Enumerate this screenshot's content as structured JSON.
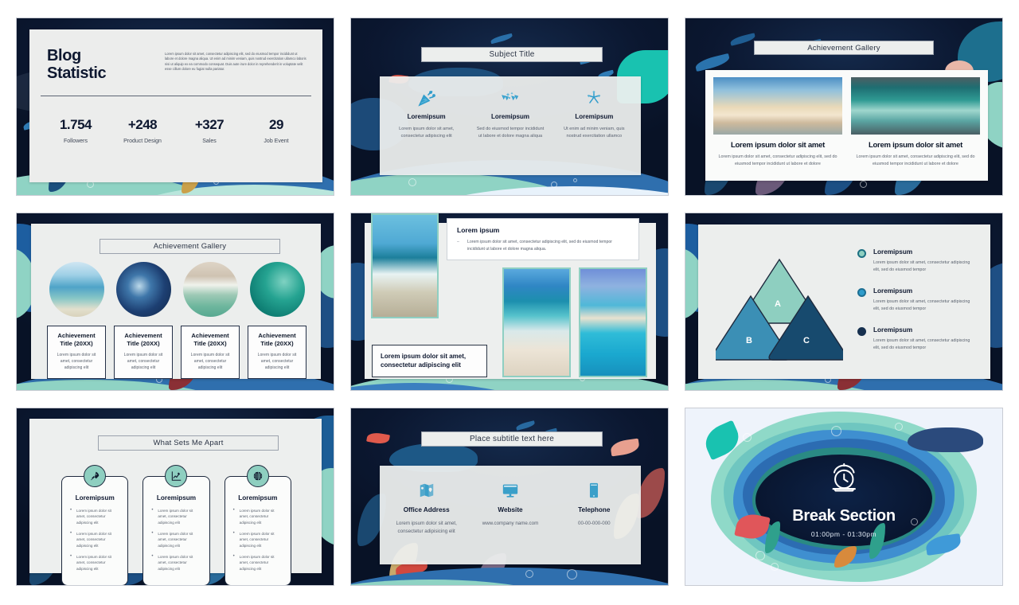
{
  "deck": {
    "theme_colors": {
      "deep_navy": "#0b1730",
      "panel_grey": "#eceeed",
      "teal": "#8ecfc0",
      "mid_blue": "#3b8fb5",
      "dark_blue": "#174a6e",
      "accent_blue": "#2f9ccb",
      "text_dark": "#0e1830",
      "text_body": "#5b636f"
    },
    "slides": [
      {
        "id": "blog-statistic",
        "title_line1": "Blog",
        "title_line2": "Statistic",
        "paragraph": "Lorem ipsum dolor sit amet, consectetur adipiscing elit, sed do eiusmod tempor incididunt ut labore et dolore magna aliqua. Ut enim ad minim veniam, quis nostrud exercitation ullamco laboris nisi ut aliquip ex ea commodo consequat. Duis aute irure dolor in reprehenderit in voluptate velit esse cillum dolore eu fugiat nulla pariatur.",
        "stats": [
          {
            "value": "1.754",
            "label": "Followers"
          },
          {
            "value": "+248",
            "label": "Product Design"
          },
          {
            "value": "+327",
            "label": "Sales"
          },
          {
            "value": "29",
            "label": "Job Event"
          }
        ]
      },
      {
        "id": "subject-title",
        "title": "Subject Title",
        "columns": [
          {
            "icon": "party-popper-icon",
            "heading": "Loremipsum",
            "text": "Lorem ipsum dolor sit amet, consectetur adipiscing elit"
          },
          {
            "icon": "bunting-flags-icon",
            "heading": "Loremipsum",
            "text": "Sed do eiusmod tempor incididunt ut labore et dolore magna aliqua"
          },
          {
            "icon": "fireworks-icon",
            "heading": "Loremipsum",
            "text": "Ut enim ad minim veniam, quis nostrud exercitation ullamco"
          }
        ]
      },
      {
        "id": "achievement-gallery-two-up",
        "title": "Achievement Gallery",
        "cards": [
          {
            "image": "beach-sunset-birds-photo",
            "heading": "Lorem ipsum dolor sit amet",
            "text": "Lorem ipsum dolor sit amet, consectetur adipiscing elit, sed do eiusmod tempor incididunt ut labore et dolore"
          },
          {
            "image": "ocean-wave-photo",
            "heading": "Lorem ipsum dolor sit amet",
            "text": "Lorem ipsum dolor sit amet, consectetur adipiscing elit, sed do eiusmod tempor incididunt ut labore et dolore"
          }
        ]
      },
      {
        "id": "achievement-gallery-four-up",
        "title": "Achievement Gallery",
        "cards": [
          {
            "image": "beach-crowd-photo",
            "heading": "Achievement Title (20XX)",
            "text": "Lorem ipsum dolor sit amet, consectetur adipiscing elit"
          },
          {
            "image": "surfer-barrel-wave-photo",
            "heading": "Achievement Title (20XX)",
            "text": "Lorem ipsum dolor sit amet, consectetur adipiscing elit"
          },
          {
            "image": "aerial-shoreline-photo",
            "heading": "Achievement Title (20XX)",
            "text": "Lorem ipsum dolor sit amet, consectetur adipiscing elit"
          },
          {
            "image": "teal-surf-photo",
            "heading": "Achievement Title (20XX)",
            "text": "Lorem ipsum dolor sit amet, consectetur adipiscing elit"
          }
        ]
      },
      {
        "id": "photo-collage",
        "note_heading": "Lorem ipsum",
        "note_bullet": "Lorem ipsum dolor sit amet, consectetur adipiscing elit, sed do eiusmod tempor incididunt ut labore et dolore magna aliqua.",
        "caption": "Lorem ipsum dolor sit amet, consectetur adipiscing elit",
        "images": [
          "shore-wave-photo",
          "white-sand-beach-photo",
          "turquoise-lagoon-photo"
        ]
      },
      {
        "id": "triangle-diagram",
        "triangles": [
          {
            "label": "A",
            "color": "#8ecfc0"
          },
          {
            "label": "B",
            "color": "#3b8fb5"
          },
          {
            "label": "C",
            "color": "#174a6e"
          }
        ],
        "legend": [
          {
            "color": "#8ecfc0",
            "heading": "Loremipsum",
            "text": "Lorem ipsum dolor sit amet, consectetur adipiscing elit, sed do eiusmod tempor"
          },
          {
            "color": "#2f9ccb",
            "heading": "Loremipsum",
            "text": "Lorem ipsum dolor sit amet, consectetur adipiscing elit, sed do eiusmod tempor"
          },
          {
            "color": "#16304f",
            "heading": "Loremipsum",
            "text": "Lorem ipsum dolor sit amet, consectetur adipiscing elit, sed do eiusmod tempor"
          }
        ]
      },
      {
        "id": "what-sets-me-apart",
        "title": "What Sets Me Apart",
        "columns": [
          {
            "icon": "rocket-icon",
            "heading": "Loremipsum",
            "bullets": [
              "Lorem ipsum dolor sit amet, consectetur adipiscing elit",
              "Lorem ipsum dolor sit amet, consectetur adipiscing elit",
              "Lorem ipsum dolor sit amet, consectetur adipiscing elit"
            ]
          },
          {
            "icon": "chart-pencil-icon",
            "heading": "Loremipsum",
            "bullets": [
              "Lorem ipsum dolor sit amet, consectetur adipiscing elit",
              "Lorem ipsum dolor sit amet, consectetur adipiscing elit",
              "Lorem ipsum dolor sit amet, consectetur adipiscing elit"
            ]
          },
          {
            "icon": "globe-target-icon",
            "heading": "Loremipsum",
            "bullets": [
              "Lorem ipsum dolor sit amet, consectetur adipiscing elit",
              "Lorem ipsum dolor sit amet, consectetur adipiscing elit",
              "Lorem ipsum dolor sit amet, consectetur adipiscing elit"
            ]
          }
        ]
      },
      {
        "id": "contact",
        "title": "Place subtitle text here",
        "columns": [
          {
            "icon": "map-location-icon",
            "heading": "Office Address",
            "text": "Lorem ipsum dolor sit amet, consectetur adipisicing elit"
          },
          {
            "icon": "desktop-monitor-icon",
            "heading": "Website",
            "text": "www.company name.com"
          },
          {
            "icon": "mobile-phone-icon",
            "heading": "Telephone",
            "text": "00-00-000-000"
          }
        ]
      },
      {
        "id": "break-section",
        "icon": "alarm-clock-icon",
        "heading": "Break Section",
        "time": "01:00pm - 01:30pm"
      }
    ]
  }
}
